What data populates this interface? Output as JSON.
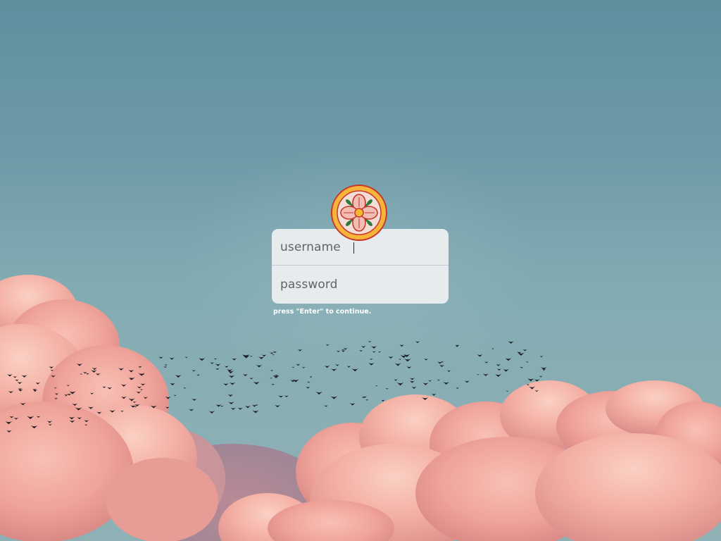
{
  "login": {
    "username_placeholder": "username",
    "password_placeholder": "password",
    "hint": "press \"Enter\" to continue.",
    "logo_icon": "flower-emblem-icon"
  },
  "colors": {
    "sky_top": "#5e8f9e",
    "sky_bottom": "#8fb1b5",
    "cloud": "#f0a39a",
    "card_background": "#e6ebee",
    "logo_ring": "#f6b53a",
    "logo_petal": "#f4c9c2",
    "logo_outline": "#c5382b",
    "logo_leaf": "#2f7a3a"
  }
}
